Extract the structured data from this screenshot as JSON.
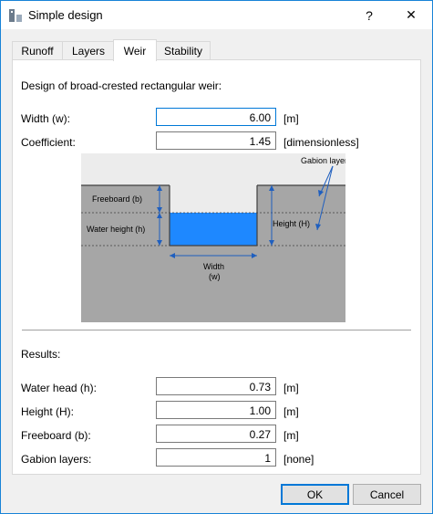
{
  "window": {
    "title": "Simple design",
    "help_glyph": "?",
    "close_glyph": "✕"
  },
  "tabs": [
    {
      "label": "Runoff"
    },
    {
      "label": "Layers"
    },
    {
      "label": "Weir"
    },
    {
      "label": "Stability"
    }
  ],
  "design": {
    "heading": "Design of broad-crested rectangular weir:",
    "width_label": "Width (w):",
    "width_value": "6.00",
    "width_unit": "[m]",
    "coef_label": "Coefficient:",
    "coef_value": "1.45",
    "coef_unit": "[dimensionless]"
  },
  "diagram": {
    "gabion_layers": "Gabion layers",
    "freeboard": "Freeboard (b)",
    "water_height": "Water height (h)",
    "height": "Height (H)",
    "width_line1": "Width",
    "width_line2": "(w)"
  },
  "results": {
    "heading": "Results:",
    "water_head_label": "Water head (h):",
    "water_head_value": "0.73",
    "water_head_unit": "[m]",
    "height_label": "Height (H):",
    "height_value": "1.00",
    "height_unit": "[m]",
    "freeboard_label": "Freeboard (b):",
    "freeboard_value": "0.27",
    "freeboard_unit": "[m]",
    "gabion_label": "Gabion layers:",
    "gabion_value": "1",
    "gabion_unit": "[none]"
  },
  "buttons": {
    "ok": "OK",
    "cancel": "Cancel"
  },
  "colors": {
    "accent": "#0078d7",
    "water": "#1e88ff",
    "gabion": "#a6a6a6"
  }
}
